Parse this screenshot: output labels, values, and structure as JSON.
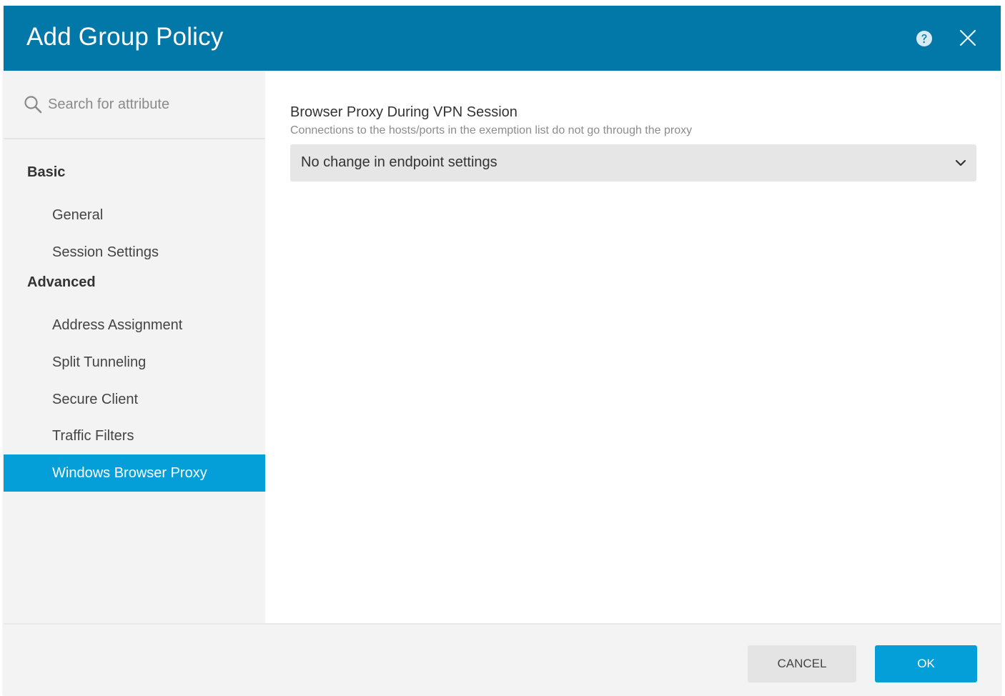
{
  "dialog": {
    "title": "Add Group Policy",
    "help_icon": "question-circle-icon",
    "close_icon": "close-x-icon"
  },
  "sidebar": {
    "search": {
      "placeholder": "Search for attribute",
      "value": "",
      "icon": "search-icon"
    },
    "groups": [
      {
        "label": "Basic",
        "items": [
          {
            "label": "General"
          },
          {
            "label": "Session Settings"
          }
        ]
      },
      {
        "label": "Advanced",
        "items": [
          {
            "label": "Address Assignment"
          },
          {
            "label": "Split Tunneling"
          },
          {
            "label": "Secure Client"
          },
          {
            "label": "Traffic Filters"
          },
          {
            "label": "Windows Browser Proxy",
            "active": true
          }
        ]
      }
    ]
  },
  "content": {
    "field_label": "Browser Proxy During VPN Session",
    "field_help": "Connections to the hosts/ports in the exemption list do not go through the proxy",
    "select": {
      "value": "No change in endpoint settings",
      "icon": "chevron-down-icon"
    }
  },
  "footer": {
    "cancel_label": "CANCEL",
    "ok_label": "OK"
  },
  "colors": {
    "header": "#0278a8",
    "accent": "#049fd9",
    "sidebar_bg": "#f3f3f3"
  }
}
